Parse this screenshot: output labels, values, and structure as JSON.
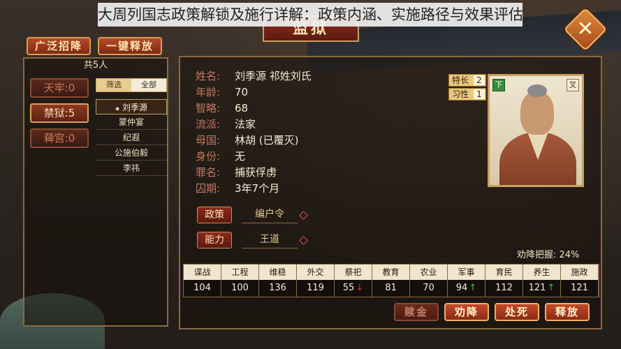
{
  "banner": "大周列国志政策解锁及施行详解：政策内涵、实施路径与效果评估",
  "window_title": "监狱",
  "close_label": "✕",
  "top_buttons": {
    "recruit": "广泛招降",
    "release_all": "一键释放"
  },
  "left": {
    "count": "共5人",
    "cells": [
      {
        "label": "天牢:0"
      },
      {
        "label": "禁狱:5"
      },
      {
        "label": "薭宫:0"
      }
    ],
    "filter": {
      "a": "筛选",
      "b": "全部"
    },
    "names": [
      "刘季源",
      "蒙仲宴",
      "纪遐",
      "公施伯毅",
      "李祎"
    ],
    "selected_marker": "◆"
  },
  "info": {
    "name": {
      "key": "姓名:",
      "val": "刘季源 祁姓刘氏"
    },
    "age": {
      "key": "年龄:",
      "val": "70"
    },
    "wisdom": {
      "key": "智略:",
      "val": "68"
    },
    "school": {
      "key": "流派:",
      "val": "法家"
    },
    "nation": {
      "key": "母国:",
      "val": "林胡 (已覆灭)"
    },
    "identity": {
      "key": "身份:",
      "val": "无"
    },
    "crime": {
      "key": "罪名:",
      "val": "捕获俘虏"
    },
    "term": {
      "key": "囚期:",
      "val": "3年7个月"
    }
  },
  "tags": [
    {
      "label": "特长",
      "num": "2"
    },
    {
      "label": "习性",
      "num": "1"
    }
  ],
  "portrait": {
    "badge_left": "下",
    "badge_right": "叉"
  },
  "policy": {
    "btn": "政策",
    "val": "编户令"
  },
  "ability": {
    "btn": "能力",
    "val": "王道"
  },
  "surrender": "劝降把握: 24%",
  "stats": {
    "heads": [
      "谍战",
      "工程",
      "维稳",
      "外交",
      "祭祀",
      "教育",
      "农业",
      "军事",
      "育民",
      "养生",
      "施政"
    ],
    "vals": [
      "104",
      "100",
      "136",
      "119",
      "55",
      "81",
      "70",
      "94",
      "112",
      "121",
      "121"
    ],
    "arrows": [
      "",
      "",
      "",
      "",
      "down",
      "",
      "",
      "up",
      "",
      "up",
      ""
    ]
  },
  "actions": {
    "ransom": "赎金",
    "persuade": "劝降",
    "execute": "处死",
    "release": "释放"
  },
  "arrow_up": "↑",
  "arrow_down": "↓"
}
